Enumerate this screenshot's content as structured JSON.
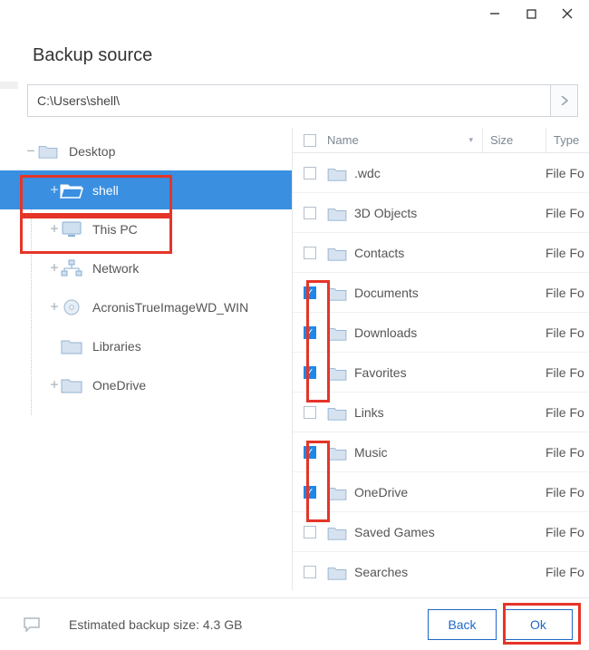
{
  "header": {
    "title": "Backup source"
  },
  "path": {
    "value": "C:\\Users\\shell\\"
  },
  "tree": {
    "items": [
      {
        "label": "Desktop"
      },
      {
        "label": "shell"
      },
      {
        "label": "This PC"
      },
      {
        "label": "Network"
      },
      {
        "label": "AcronisTrueImageWD_WIN"
      },
      {
        "label": "Libraries"
      },
      {
        "label": "OneDrive"
      }
    ]
  },
  "columns": {
    "name": "Name",
    "size": "Size",
    "type": "Type"
  },
  "rows": [
    {
      "name": ".wdc",
      "checked": false,
      "type": "File Fo"
    },
    {
      "name": "3D Objects",
      "checked": false,
      "type": "File Fo"
    },
    {
      "name": "Contacts",
      "checked": false,
      "type": "File Fo"
    },
    {
      "name": "Documents",
      "checked": true,
      "type": "File Fo"
    },
    {
      "name": "Downloads",
      "checked": true,
      "type": "File Fo"
    },
    {
      "name": "Favorites",
      "checked": true,
      "type": "File Fo"
    },
    {
      "name": "Links",
      "checked": false,
      "type": "File Fo"
    },
    {
      "name": "Music",
      "checked": true,
      "type": "File Fo"
    },
    {
      "name": "OneDrive",
      "checked": true,
      "type": "File Fo"
    },
    {
      "name": "Saved Games",
      "checked": false,
      "type": "File Fo"
    },
    {
      "name": "Searches",
      "checked": false,
      "type": "File Fo"
    }
  ],
  "footer": {
    "estimate": "Estimated backup size: 4.3 GB",
    "back": "Back",
    "ok": "Ok"
  }
}
